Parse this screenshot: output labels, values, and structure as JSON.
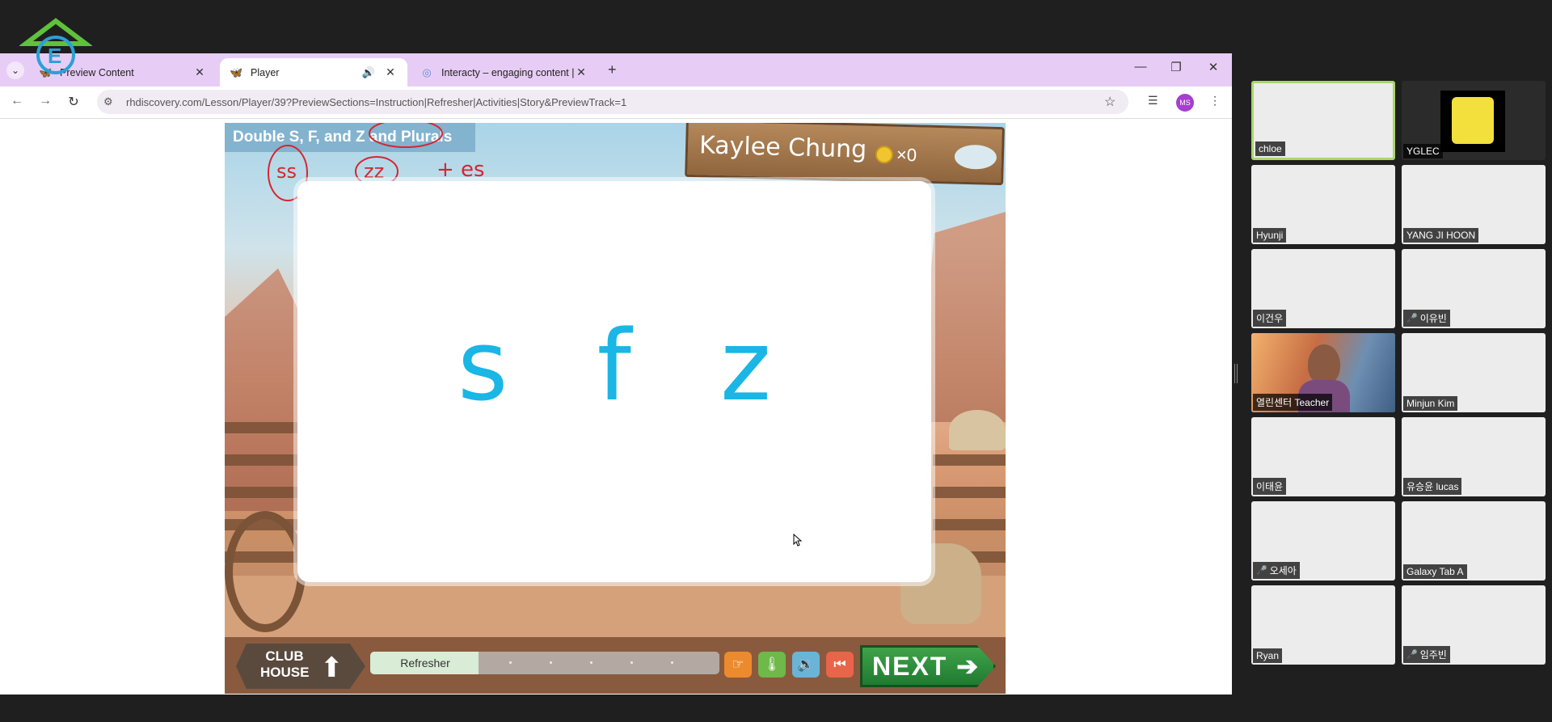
{
  "browser": {
    "tabs": [
      {
        "label": "Preview Content",
        "icon": "butterfly-icon"
      },
      {
        "label": "Player",
        "icon": "butterfly-icon"
      },
      {
        "label": "Interacty – engaging content |",
        "icon": "interacty-icon"
      }
    ],
    "url": "rhdiscovery.com/Lesson/Player/39?PreviewSections=Instruction|Refresher|Activities|Story&PreviewTrack=1",
    "profile_initials": "MS"
  },
  "lesson": {
    "title": "Double S, F, and Z and Plurals",
    "student_name": "Kaylee Chung",
    "coin_count": "×0",
    "annotations": {
      "ss": "ss",
      "comma": ",",
      "zz": "zz",
      "es": "+ es"
    },
    "letters": [
      "s",
      "f",
      "z"
    ],
    "club_house_label": "CLUB HOUSE",
    "progress_label": "Refresher",
    "progress_fraction": 0.31,
    "next_label": "NEXT"
  },
  "participants": [
    {
      "name": "chloe",
      "muted": false,
      "speaking": true,
      "video": "blank"
    },
    {
      "name": "YGLEC",
      "muted": false,
      "speaking": false,
      "video": "spongebob"
    },
    {
      "name": "Hyunji",
      "muted": false,
      "speaking": false,
      "video": "blank"
    },
    {
      "name": "YANG JI HOON",
      "muted": false,
      "speaking": false,
      "video": "blank"
    },
    {
      "name": "이건우",
      "muted": false,
      "speaking": false,
      "video": "blank"
    },
    {
      "name": "이유빈",
      "muted": true,
      "speaking": false,
      "video": "blank"
    },
    {
      "name": "열린센터 Teacher",
      "muted": false,
      "speaking": false,
      "video": "teacher"
    },
    {
      "name": "Minjun Kim",
      "muted": false,
      "speaking": false,
      "video": "blank"
    },
    {
      "name": "이태윤",
      "muted": false,
      "speaking": false,
      "video": "blank"
    },
    {
      "name": "유승윤 lucas",
      "muted": false,
      "speaking": false,
      "video": "blank"
    },
    {
      "name": "오세아",
      "muted": true,
      "speaking": false,
      "video": "blank"
    },
    {
      "name": "Galaxy Tab A",
      "muted": false,
      "speaking": false,
      "video": "blank"
    },
    {
      "name": "Ryan",
      "muted": false,
      "speaking": false,
      "video": "blank"
    },
    {
      "name": "임주빈",
      "muted": true,
      "speaking": false,
      "video": "blank"
    }
  ],
  "colors": {
    "tab_bar": "#e7cdf5",
    "letters": "#19b6e6",
    "next_button": "#2f8f3c",
    "annotation_ink": "#d6262e",
    "speaking_border": "#a8d86a"
  }
}
